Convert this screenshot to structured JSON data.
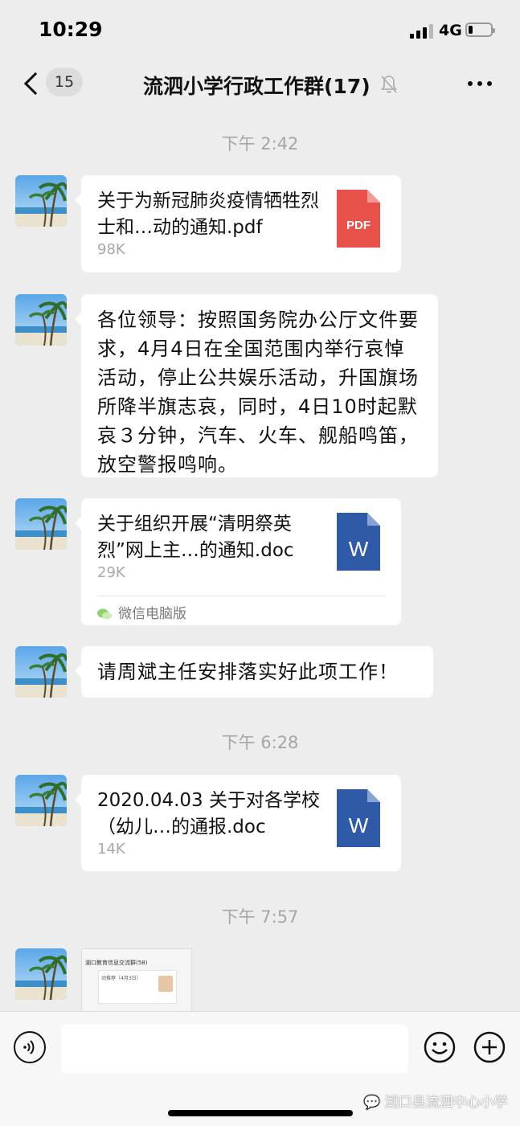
{
  "status_bar": {
    "time": "10:29",
    "network": "4G",
    "battery_level": 0.2
  },
  "nav": {
    "unread_count": "15",
    "title": "流泗小学行政工作群(17)"
  },
  "timestamps": [
    "下午 2:42",
    "下午 6:28",
    "下午 7:57"
  ],
  "messages": [
    {
      "type": "file",
      "name": "关于为新冠肺炎疫情牺牲烈士和…动的通知.pdf",
      "size": "98K",
      "icon": "pdf-icon",
      "icon_label": "PDF",
      "icon_color": "#e8514a"
    },
    {
      "type": "text",
      "text": "各位领导：按照国务院办公厅文件要求，4月4日在全国范围内举行哀悼活动，停止公共娱乐活动，升国旗场所降半旗志哀，同时，4日10时起默哀３分钟，汽车、火车、舰船鸣笛，放空警报鸣响。"
    },
    {
      "type": "file",
      "name": "关于组织开展“清明祭英烈”网上主…的通知.doc",
      "size": "29K",
      "icon": "word-icon",
      "icon_label": "W",
      "icon_color": "#2f5aa8",
      "source": "微信电脑版"
    },
    {
      "type": "text",
      "text": "请周斌主任安排落实好此项工作！"
    },
    {
      "type": "file",
      "name": "2020.04.03 关于对各学校（幼儿…的通报.doc",
      "size": "14K",
      "icon": "word-icon",
      "icon_label": "W",
      "icon_color": "#2f5aa8"
    },
    {
      "type": "image",
      "thumb_title": "湖口教育信息交流群(58)",
      "thumb_line": "动推荐（4月3日）"
    }
  ],
  "watermark": "湖口县流泗中心小学"
}
